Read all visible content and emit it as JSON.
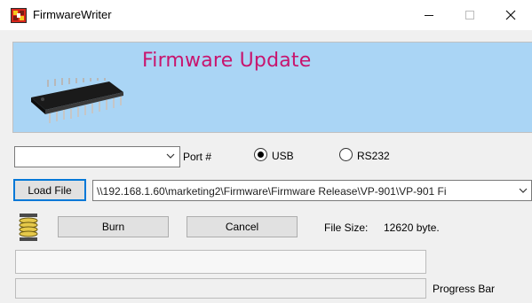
{
  "window": {
    "title": "FirmwareWriter",
    "minimize_glyph": "—",
    "maximize_glyph": "☐",
    "close_glyph": "✕"
  },
  "banner": {
    "title": "Firmware Update"
  },
  "port": {
    "combo_value": "",
    "label": "Port #",
    "options": [
      {
        "label": "USB",
        "selected": true
      },
      {
        "label": "RS232",
        "selected": false
      }
    ]
  },
  "file": {
    "load_button": "Load File",
    "path": "\\\\192.168.1.60\\marketing2\\Firmware\\Firmware Release\\VP-901\\VP-901 Fi"
  },
  "actions": {
    "burn_button": "Burn",
    "cancel_button": "Cancel",
    "file_size_label": "File Size:",
    "file_size_value": "12620 byte."
  },
  "status": {
    "message": "",
    "progress_percent": 0,
    "progress_label": "Progress Bar"
  },
  "colors": {
    "banner_bg": "#aad5f5",
    "title_accent": "#c8156e",
    "focus_border": "#0078d7"
  },
  "icons": {
    "app": "firmware-writer-icon",
    "chip": "ic-chip-image",
    "spring": "spring-coil-icon"
  }
}
